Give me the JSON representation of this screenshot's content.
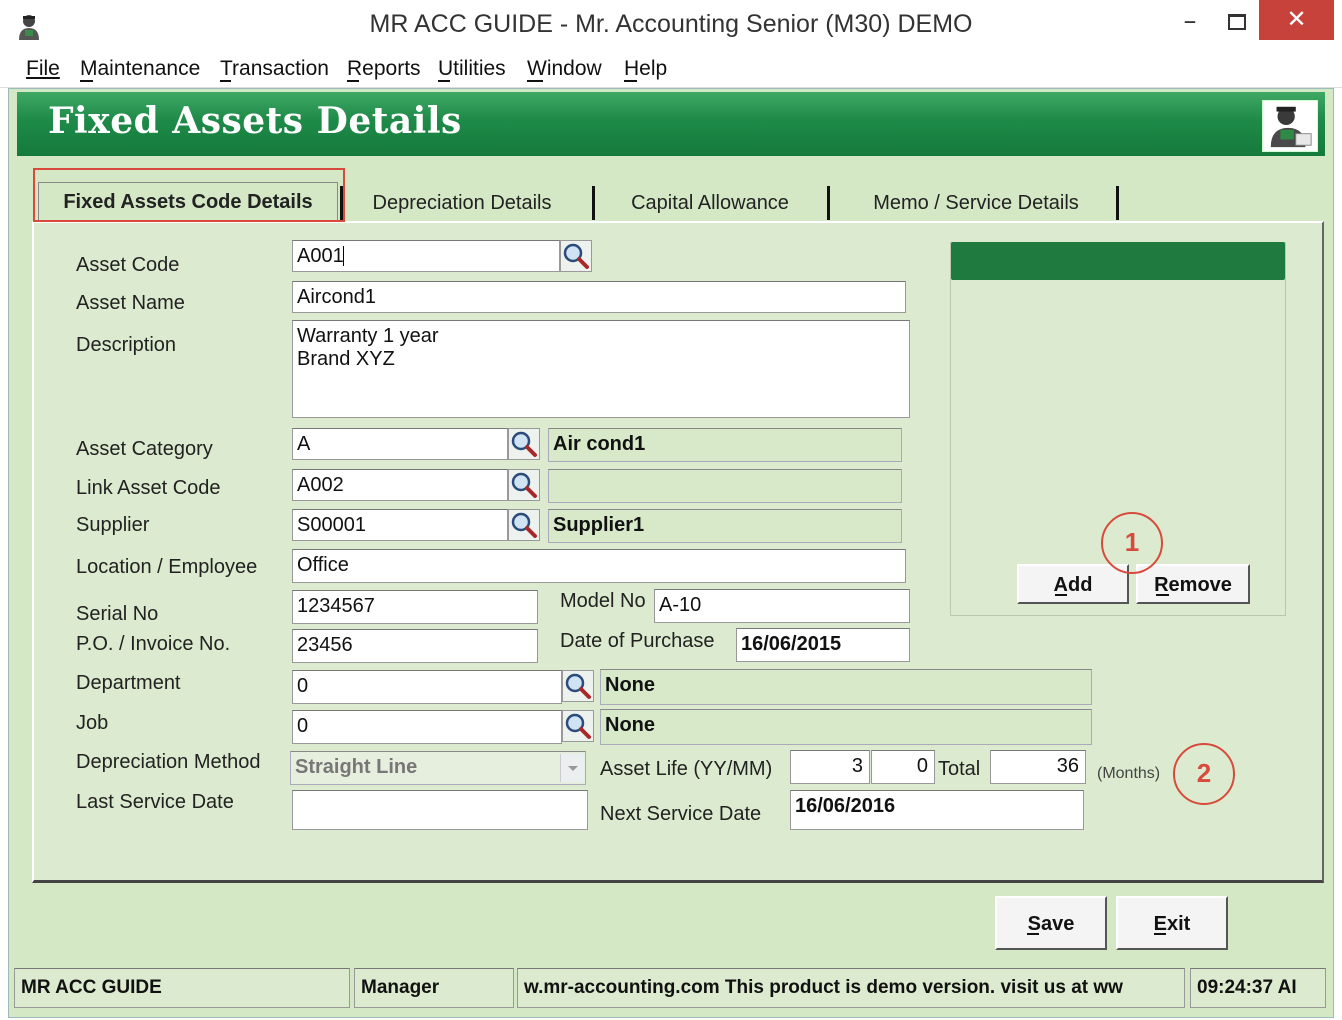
{
  "window": {
    "title": "MR ACC GUIDE - Mr. Accounting Senior (M30) DEMO",
    "minimize_glyph": "–",
    "close_glyph": "✕"
  },
  "menu": {
    "file": "File",
    "maintenance": "Maintenance",
    "transaction": "Transaction",
    "reports": "Reports",
    "utilities": "Utilities",
    "window": "Window",
    "help": "Help"
  },
  "banner": {
    "title": "Fixed Assets Details"
  },
  "tabs": [
    {
      "label": "Fixed Assets Code Details"
    },
    {
      "label": "Depreciation Details"
    },
    {
      "label": "Capital Allowance"
    },
    {
      "label": "Memo / Service Details"
    }
  ],
  "form": {
    "asset_code": {
      "label": "Asset Code",
      "value": "A001"
    },
    "asset_name": {
      "label": "Asset Name",
      "value": "Aircond1"
    },
    "description": {
      "label": "Description",
      "value": "Warranty 1 year\nBrand XYZ"
    },
    "asset_category": {
      "label": "Asset Category",
      "value": "A",
      "name": "Air cond1"
    },
    "link_asset_code": {
      "label": "Link Asset Code",
      "value": "A002",
      "name": ""
    },
    "supplier": {
      "label": "Supplier",
      "value": "S00001",
      "name": "Supplier1"
    },
    "location": {
      "label": "Location / Employee",
      "value": "Office"
    },
    "serial_no": {
      "label": "Serial No",
      "value": "1234567"
    },
    "model_no": {
      "label": "Model No",
      "value": "A-10"
    },
    "po_invoice": {
      "label": "P.O. / Invoice No.",
      "value": "23456"
    },
    "date_of_purchase": {
      "label": "Date of Purchase",
      "value": "16/06/2015"
    },
    "department": {
      "label": "Department",
      "value": "0",
      "name": "None"
    },
    "job": {
      "label": "Job",
      "value": "0",
      "name": "None"
    },
    "depreciation_method": {
      "label": "Depreciation Method",
      "value": "Straight Line"
    },
    "asset_life": {
      "label": "Asset Life (YY/MM)",
      "years": "3",
      "months": "0",
      "total_label": "Total",
      "total": "36",
      "unit": "(Months)"
    },
    "last_service_date": {
      "label": "Last Service Date",
      "value": ""
    },
    "next_service_date": {
      "label": "Next Service Date",
      "value": "16/06/2016"
    }
  },
  "side_panel": {
    "add_label": "Add",
    "remove_label": "Remove"
  },
  "annotations": {
    "one": "1",
    "two": "2"
  },
  "buttons": {
    "save": "Save",
    "exit": "Exit"
  },
  "status_bar": {
    "company": "MR ACC GUIDE",
    "user": "Manager",
    "message": "w.mr-accounting.com This product is demo version.  visit us at ww",
    "time": "09:24:37 AI"
  },
  "icons": {
    "app": "app-logo-icon",
    "lookup": "magnifier-icon",
    "dropdown": "chevron-down-icon"
  }
}
